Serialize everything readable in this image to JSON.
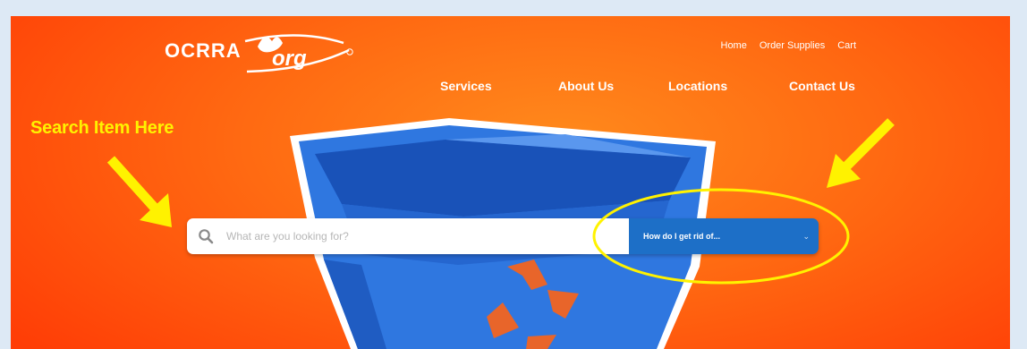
{
  "logo": {
    "primary": "OCRRA",
    "suffix": "org",
    "registered": "®"
  },
  "utility_nav": [
    "Home",
    "Order Supplies",
    "Cart"
  ],
  "main_nav": [
    "Services",
    "About Us",
    "Locations",
    "Contact Us"
  ],
  "annotation": {
    "label": "Search Item Here",
    "color": "#fff200"
  },
  "search": {
    "placeholder": "What are you looking for?",
    "value": ""
  },
  "dropdown": {
    "selected": "How do I get rid of..."
  },
  "icons": [
    "search-icon",
    "chevron-down-icon",
    "recycle-icon",
    "arrow-icon"
  ],
  "colors": {
    "brand_orange": "#ff6a12",
    "dropdown_blue": "#1d6fc7",
    "bin_blue": "#2f77e0",
    "highlight_yellow": "#fff200",
    "recycle_orange": "#e8652a"
  }
}
